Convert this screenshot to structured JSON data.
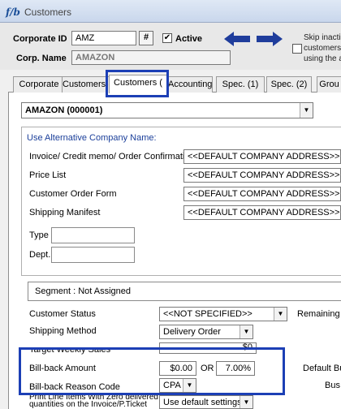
{
  "window": {
    "app_icon": "f/b",
    "title": "Customers"
  },
  "header": {
    "corporate_id_label": "Corporate ID",
    "corporate_id_value": "AMZ",
    "hash_button": "#",
    "active_label": "Active",
    "active_checked": "✔",
    "corp_name_label": "Corp. Name",
    "corp_name_value": "AMAZON",
    "skip_text": [
      "Skip inacti",
      "customers",
      "using the a"
    ]
  },
  "tabs": [
    "Corporate",
    "Customers (",
    "Customers (",
    "Accounting",
    "Spec. (1)",
    "Spec. (2)",
    "Grou"
  ],
  "company_select": "AMAZON  (000001)",
  "alt_company": {
    "title": "Use Alternative Company Name:",
    "rows": [
      {
        "label": "Invoice/ Credit memo/ Order Confirmation",
        "value": "<<DEFAULT COMPANY ADDRESS>>"
      },
      {
        "label": "Price List",
        "value": "<<DEFAULT COMPANY ADDRESS>>"
      },
      {
        "label": "Customer Order Form",
        "value": "<<DEFAULT COMPANY ADDRESS>>"
      },
      {
        "label": "Shipping Manifest",
        "value": "<<DEFAULT COMPANY ADDRESS>>"
      }
    ],
    "type_label": "Type",
    "dept_label": "Dept."
  },
  "segment": "Segment : Not Assigned",
  "status": {
    "customer_status_label": "Customer Status",
    "customer_status_value": "<<NOT SPECIFIED>>",
    "remaining_label": "Remaining S",
    "shipping_method_label": "Shipping Method",
    "shipping_method_value": "Delivery Order",
    "target_label": "Target Weekly Sales",
    "target_value": "$0",
    "billback_amount_label": "Bill-back Amount",
    "billback_amount_value": "$0.00",
    "or_label": "OR",
    "billback_percent_value": "7.00%",
    "default_bu_label": "Default Bu",
    "billback_reason_label": "Bill-back Reason Code",
    "billback_reason_value": "CPA",
    "bus_label": "Bus",
    "print_line_label": "Print Line Items With Zero delivered quantities on the Invoice/P.Ticket",
    "print_line_value": "Use default settings"
  }
}
